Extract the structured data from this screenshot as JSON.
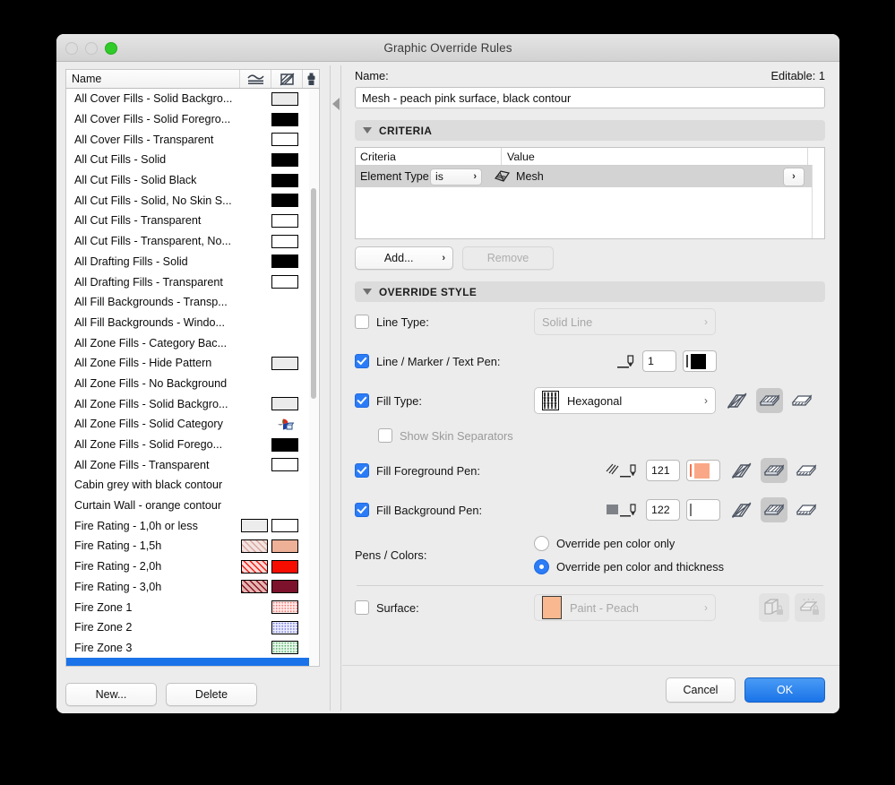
{
  "window": {
    "title": "Graphic Override Rules",
    "traffic": [
      "close-button",
      "minimize-button",
      "zoom-button"
    ]
  },
  "left_panel": {
    "header": {
      "name_column": "Name",
      "icons": [
        "line-type-icon",
        "fill-type-icon",
        "surface-icon"
      ]
    },
    "rows": [
      {
        "label": "All Cover Fills - Solid Backgro...",
        "swatches": [
          {
            "type": "solid",
            "color": "#ebebeb"
          }
        ]
      },
      {
        "label": "All Cover Fills - Solid Foregro...",
        "swatches": [
          {
            "type": "solid",
            "color": "#000000"
          }
        ]
      },
      {
        "label": "All Cover Fills - Transparent",
        "swatches": [
          {
            "type": "solid",
            "color": "#ffffff"
          }
        ]
      },
      {
        "label": "All Cut Fills - Solid",
        "swatches": [
          {
            "type": "solid",
            "color": "#000000"
          }
        ]
      },
      {
        "label": "All Cut Fills - Solid Black",
        "swatches": [
          {
            "type": "solid",
            "color": "#000000"
          }
        ]
      },
      {
        "label": "All Cut Fills - Solid, No Skin S...",
        "swatches": [
          {
            "type": "solid",
            "color": "#000000"
          }
        ]
      },
      {
        "label": "All Cut Fills - Transparent",
        "swatches": [
          {
            "type": "solid",
            "color": "#ffffff"
          }
        ]
      },
      {
        "label": "All Cut Fills - Transparent, No...",
        "swatches": [
          {
            "type": "solid",
            "color": "#ffffff"
          }
        ]
      },
      {
        "label": "All Drafting Fills - Solid",
        "swatches": [
          {
            "type": "solid",
            "color": "#000000"
          }
        ]
      },
      {
        "label": "All Drafting Fills - Transparent",
        "swatches": [
          {
            "type": "solid",
            "color": "#ffffff"
          }
        ]
      },
      {
        "label": "All Fill Backgrounds - Transp...",
        "swatches": []
      },
      {
        "label": "All Fill Backgrounds - Windo...",
        "swatches": []
      },
      {
        "label": "All Zone Fills - Category Bac...",
        "swatches": []
      },
      {
        "label": "All Zone Fills - Hide Pattern",
        "swatches": [
          {
            "type": "solid",
            "color": "#ebebeb"
          }
        ]
      },
      {
        "label": "All Zone Fills - No Background",
        "swatches": []
      },
      {
        "label": "All Zone Fills - Solid Backgro...",
        "swatches": [
          {
            "type": "solid",
            "color": "#ebebeb"
          }
        ]
      },
      {
        "label": "All Zone Fills - Solid Category",
        "swatches": [
          {
            "type": "category-icon"
          }
        ]
      },
      {
        "label": "All Zone Fills - Solid Forego...",
        "swatches": [
          {
            "type": "solid",
            "color": "#000000"
          }
        ]
      },
      {
        "label": "All Zone Fills - Transparent",
        "swatches": [
          {
            "type": "solid",
            "color": "#ffffff"
          }
        ]
      },
      {
        "label": "Cabin grey with black contour",
        "swatches": []
      },
      {
        "label": "Curtain Wall - orange contour",
        "swatches": []
      },
      {
        "label": "Fire Rating - 1,0h or less",
        "swatches": [
          {
            "type": "solid",
            "color": "#ececec"
          },
          {
            "type": "solid",
            "color": "#ffffff"
          }
        ]
      },
      {
        "label": "Fire Rating - 1,5h",
        "swatches": [
          {
            "type": "hatch",
            "color": "#d9a79f",
            "bg": "#f2e3e1"
          },
          {
            "type": "solid",
            "color": "#eeb198"
          }
        ]
      },
      {
        "label": "Fire Rating - 2,0h",
        "swatches": [
          {
            "type": "hatch",
            "color": "#ee2119",
            "bg": "#ffd9d6"
          },
          {
            "type": "solid",
            "color": "#f60d00"
          }
        ]
      },
      {
        "label": "Fire Rating - 3,0h",
        "swatches": [
          {
            "type": "hatch",
            "color": "#8d1321",
            "bg": "#e4b5b3"
          },
          {
            "type": "solid",
            "color": "#7c122c"
          }
        ]
      },
      {
        "label": "Fire Zone 1",
        "swatches": [
          {
            "type": "dots",
            "color": "#f06a62",
            "bg": "#ffeceb"
          }
        ]
      },
      {
        "label": "Fire Zone 2",
        "swatches": [
          {
            "type": "dots",
            "color": "#6a72e0",
            "bg": "#ecedfb"
          }
        ]
      },
      {
        "label": "Fire Zone 3",
        "swatches": [
          {
            "type": "dots",
            "color": "#49a95a",
            "bg": "#e9f7ec"
          }
        ]
      },
      {
        "label": "",
        "swatches": [],
        "selected": true
      }
    ],
    "footer": {
      "new_label": "New...",
      "delete_label": "Delete"
    }
  },
  "right_panel": {
    "name_label": "Name:",
    "editable_label": "Editable: 1",
    "name_value": "Mesh - peach pink surface, black contour",
    "criteria_section": {
      "title": "CRITERIA",
      "columns": {
        "criteria": "Criteria",
        "value": "Value"
      },
      "rows": [
        {
          "criteria": "Element Type",
          "operator": "is",
          "value": "Mesh",
          "value_icon": "mesh-icon"
        }
      ],
      "add_label": "Add...",
      "remove_label": "Remove"
    },
    "override_section": {
      "title": "OVERRIDE STYLE",
      "line_type": {
        "label": "Line Type:",
        "checked": false,
        "value": "Solid Line",
        "enabled": false
      },
      "line_marker_text_pen": {
        "label": "Line / Marker / Text Pen:",
        "checked": true,
        "pen_number": "1",
        "color": "#000000"
      },
      "fill_type": {
        "label": "Fill Type:",
        "checked": true,
        "value": "Hexagonal",
        "selected_category": 1
      },
      "show_skin_separators": {
        "label": "Show Skin Separators",
        "checked": false
      },
      "fill_foreground_pen": {
        "label": "Fill Foreground Pen:",
        "checked": true,
        "pen_number": "121",
        "color": "#f9a787",
        "selected_category": 1
      },
      "fill_background_pen": {
        "label": "Fill Background Pen:",
        "checked": true,
        "pen_number": "122",
        "color": "#ffffff",
        "selected_category": 1
      },
      "pens_colors": {
        "label": "Pens / Colors:",
        "options": [
          "Override pen color only",
          "Override pen color and thickness"
        ],
        "selected_index": 1
      },
      "surface": {
        "label": "Surface:",
        "checked": false,
        "value": "Paint - Peach",
        "swatch": "#f9b88f",
        "enabled": false
      }
    },
    "dialog_buttons": {
      "cancel": "Cancel",
      "ok": "OK"
    }
  },
  "colors": {
    "accent": "#1a73e8",
    "selection_blue": "#1a73e8",
    "window_bg": "#ececec"
  }
}
